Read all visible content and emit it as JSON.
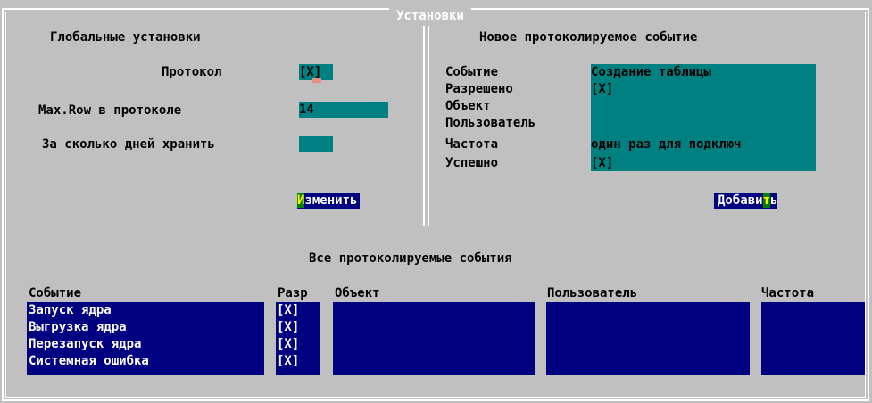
{
  "window": {
    "title": "Установки"
  },
  "global": {
    "heading": "Глобальные установки",
    "protocol_label": "Протокол",
    "protocol_value": "[X]",
    "maxrow_label": "Max.Row в протоколе",
    "maxrow_value": "14",
    "days_label": "За сколько дней хранить",
    "days_value": "",
    "change_button_hot": "И",
    "change_button_rest": "зменить"
  },
  "new_event": {
    "heading": "Новое протоколируемое событие",
    "event_label": "Событие",
    "event_value": "Создание таблицы",
    "allowed_label": "Разрешено",
    "allowed_value": "[X]",
    "object_label": "Объект",
    "object_value": "",
    "user_label": "Пользователь",
    "user_value": "",
    "frequency_label": "Частота",
    "frequency_value": "один раз для подключ",
    "success_label": "Успешно",
    "success_value": "[X]",
    "add_button_before": "Добави",
    "add_button_hot": "т",
    "add_button_after": "ь"
  },
  "all_events": {
    "heading": "Все протоколируемые события",
    "columns": [
      "Событие",
      "Разр",
      "Объект",
      "Пользователь",
      "Частота"
    ],
    "events": [
      "Запуск ядра",
      "Выгрузка ядра",
      "Перезапуск ядра",
      "Системная ошибка"
    ],
    "allowed": [
      "[X]",
      "[X]",
      "[X]",
      "[X]"
    ]
  },
  "colors": {
    "background": "#c0c0c0",
    "field": "#008080",
    "list": "#000080",
    "hotkey": "#008000"
  }
}
